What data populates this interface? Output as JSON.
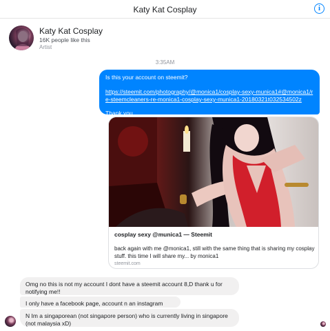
{
  "header": {
    "title": "Katy Kat Cosplay",
    "info_icon": "info-icon"
  },
  "profile": {
    "name": "Katy Kat Cosplay",
    "likes": "16K people like this",
    "category": "Artist"
  },
  "timestamp": "3:35AM",
  "outgoing": {
    "question": "Is this your account on steemit?",
    "link": "https://steemit.com/photography/@monica1/cosplay-sexy-munica1#@monica1/re-steemcleaners-re-monica1-cosplay-sexy-munica1-20180321t032534502z",
    "thanks": "Thank you."
  },
  "link_card": {
    "title": "cosplay sexy @munica1 — Steemit",
    "description": "back again with me @monica1, still with the same thing that is sharing my cosplay stuff. this time I will share my... by monica1",
    "domain": "steemit.com"
  },
  "incoming": [
    "Omg no this is not my account I dont have a steemit account 8,D thank u for notifying me!!",
    "I only have a facebook page, account n an instagram account",
    "N Im a singaporean (not singapore person) who is currently living in singapore (not malaysia xD)"
  ],
  "colors": {
    "accent": "#0084ff",
    "incoming_bubble": "#f1f0f0"
  }
}
